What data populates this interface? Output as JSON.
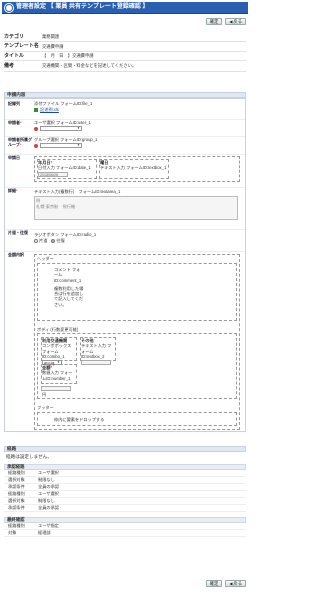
{
  "window": {
    "title": "管理者設定 【 業員 共有テンプレート登録確認 】"
  },
  "buttons": {
    "confirm": "確定",
    "back": "戻る"
  },
  "info": {
    "rows": [
      {
        "key": "カテゴリ",
        "value": "業務関連"
      },
      {
        "key": "テンプレート名",
        "value": "交通費申請"
      },
      {
        "key": "タイトル",
        "value": "【　月　日　】交通費申請"
      },
      {
        "key": "備考",
        "value": "交通機関・区間・料金などを記述してください。"
      }
    ]
  },
  "form_section": {
    "title": "申請内容",
    "rows": {
      "rec": {
        "label": "記録列",
        "line1": "添付ファイル フォームID:file_1",
        "line2": "記述例.xls"
      },
      "applicant": {
        "label": "申請者",
        "line1": "ユーザ選択 フォームID:user_1"
      },
      "group": {
        "label": "申請者所属グループ",
        "line1": "グループ選択 フォームID:group_1"
      },
      "date": {
        "label": "申請日",
        "col1": "年月日",
        "col1b": "日付入力 フォームID:date_1",
        "col1v": "2018/06/28",
        "col2": "曜日",
        "col2b": "テキスト入力 フォームID:textbox_1"
      },
      "detail": {
        "label": "詳細",
        "line1": "テキスト入力(複数行)　フォームID:textarea_1",
        "line2": "例",
        "line3": "札幌-東京駅　飛行機"
      },
      "oneway": {
        "label": "片道・往復",
        "line1": "ラジオボタン フォームID:radio_1",
        "opt1": "片道",
        "opt2": "往復"
      },
      "amount": {
        "label": "金額内訳",
        "header": "ヘッダー",
        "comment": "コメント フォームID:comment_1",
        "comment2": "複数利用した場合は行を追加して記入してください。",
        "body": "ボディ (行数変更可能)",
        "cols": [
          "利用交通機関",
          "その他"
        ],
        "col1": "コンボボックス フォームID:combo_1",
        "col1v": "飛行機",
        "col2": "テキスト入力 フォームID:textbox_2",
        "sum_label": "金額",
        "sum": "数値入力 フォームID:number_1",
        "unit": "円",
        "footer": "フッター",
        "drop": "枠内に要素をドロップする"
      }
    }
  },
  "route": {
    "title": "経路",
    "desc": "経路は設定しません。",
    "approve": {
      "title": "承認経路",
      "rows": [
        [
          "経路種別",
          "ユーザ選択"
        ],
        [
          "選択対象",
          "制限なし"
        ],
        [
          "承認条件",
          "全員の承認"
        ],
        [
          "経路種別",
          "ユーザ選択"
        ],
        [
          "選択対象",
          "制限なし"
        ],
        [
          "承認条件",
          "全員の承認"
        ]
      ]
    },
    "final": {
      "title": "最終確認",
      "rows": [
        [
          "経路種別",
          "ユーザ指定"
        ],
        [
          "対象",
          "経理部"
        ]
      ]
    }
  }
}
